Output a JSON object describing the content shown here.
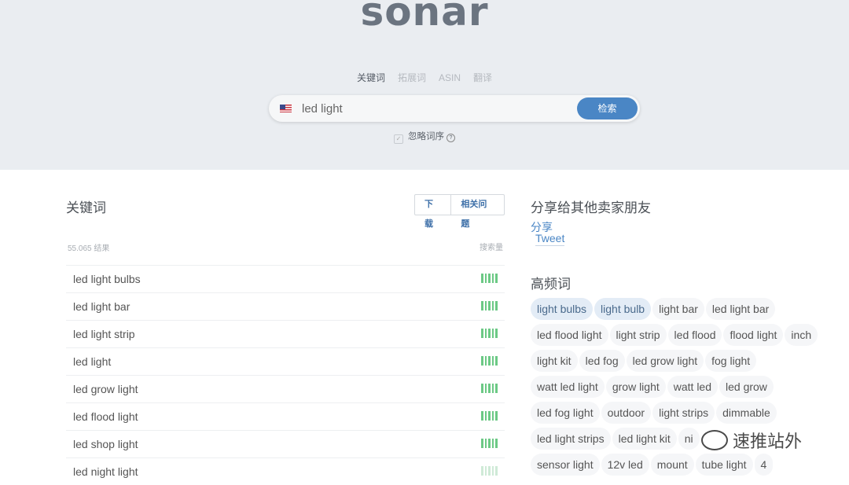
{
  "app": {
    "logo": "sonar"
  },
  "tabs": [
    {
      "label": "关键词",
      "active": true
    },
    {
      "label": "拓展词",
      "active": false
    },
    {
      "label": "ASIN",
      "active": false
    },
    {
      "label": "翻译",
      "active": false
    }
  ],
  "search": {
    "marketplace_flag": "us-flag-icon",
    "value": "led light",
    "button": "检索"
  },
  "options": {
    "ignore_order_label": "忽略词序",
    "help_icon": "question-icon",
    "help_symbol": "?"
  },
  "keywords_panel": {
    "title": "关键词",
    "download_button": "下载",
    "related_questions_button": "相关问题",
    "results_count": "55.065 结果",
    "volume_label": "搜索量",
    "rows": [
      {
        "keyword": "led light bulbs",
        "volume_bars": 5,
        "strength": "high"
      },
      {
        "keyword": "led light bar",
        "volume_bars": 5,
        "strength": "high"
      },
      {
        "keyword": "led light strip",
        "volume_bars": 5,
        "strength": "high"
      },
      {
        "keyword": "led light",
        "volume_bars": 5,
        "strength": "high"
      },
      {
        "keyword": "led grow light",
        "volume_bars": 5,
        "strength": "high"
      },
      {
        "keyword": "led flood light",
        "volume_bars": 5,
        "strength": "high"
      },
      {
        "keyword": "led shop light",
        "volume_bars": 5,
        "strength": "high"
      },
      {
        "keyword": "led night light",
        "volume_bars": 5,
        "strength": "low"
      }
    ]
  },
  "share_panel": {
    "title": "分享给其他卖家朋友",
    "share_link": "分享",
    "tweet_link": "Tweet"
  },
  "frequent_words": {
    "title": "高频词",
    "rows": [
      [
        {
          "text": "light bulbs",
          "hl": true
        },
        {
          "text": "light bulb",
          "hl": true
        },
        {
          "text": "light bar",
          "hl": false
        },
        {
          "text": "led light bar",
          "hl": false
        }
      ],
      [
        {
          "text": "led flood light",
          "hl": false
        },
        {
          "text": "light strip",
          "hl": false
        },
        {
          "text": "led flood",
          "hl": false
        },
        {
          "text": "flood light",
          "hl": false
        },
        {
          "text": "inch",
          "hl": false
        }
      ],
      [
        {
          "text": "light kit",
          "hl": false
        },
        {
          "text": "led fog",
          "hl": false
        },
        {
          "text": "led grow light",
          "hl": false
        },
        {
          "text": "fog light",
          "hl": false
        }
      ],
      [
        {
          "text": "watt led light",
          "hl": false
        },
        {
          "text": "grow light",
          "hl": false
        },
        {
          "text": "watt led",
          "hl": false
        },
        {
          "text": "led grow",
          "hl": false
        }
      ],
      [
        {
          "text": "led fog light",
          "hl": false
        },
        {
          "text": "outdoor",
          "hl": false
        },
        {
          "text": "light strips",
          "hl": false
        },
        {
          "text": "dimmable",
          "hl": false
        }
      ],
      [
        {
          "text": "led light strips",
          "hl": false
        },
        {
          "text": "led light kit",
          "hl": false
        },
        {
          "text": "ni",
          "hl": false
        }
      ],
      [
        {
          "text": "sensor light",
          "hl": false
        },
        {
          "text": "12v led",
          "hl": false
        },
        {
          "text": "mount",
          "hl": false
        },
        {
          "text": "tube light",
          "hl": false
        },
        {
          "text": "4",
          "hl": false
        }
      ]
    ]
  },
  "watermark": {
    "text": "速推站外"
  },
  "colors": {
    "accent": "#4a86c5",
    "bar_green": "#6cc985",
    "bar_light": "#cfead7",
    "hero_bg": "#eaedf1"
  }
}
